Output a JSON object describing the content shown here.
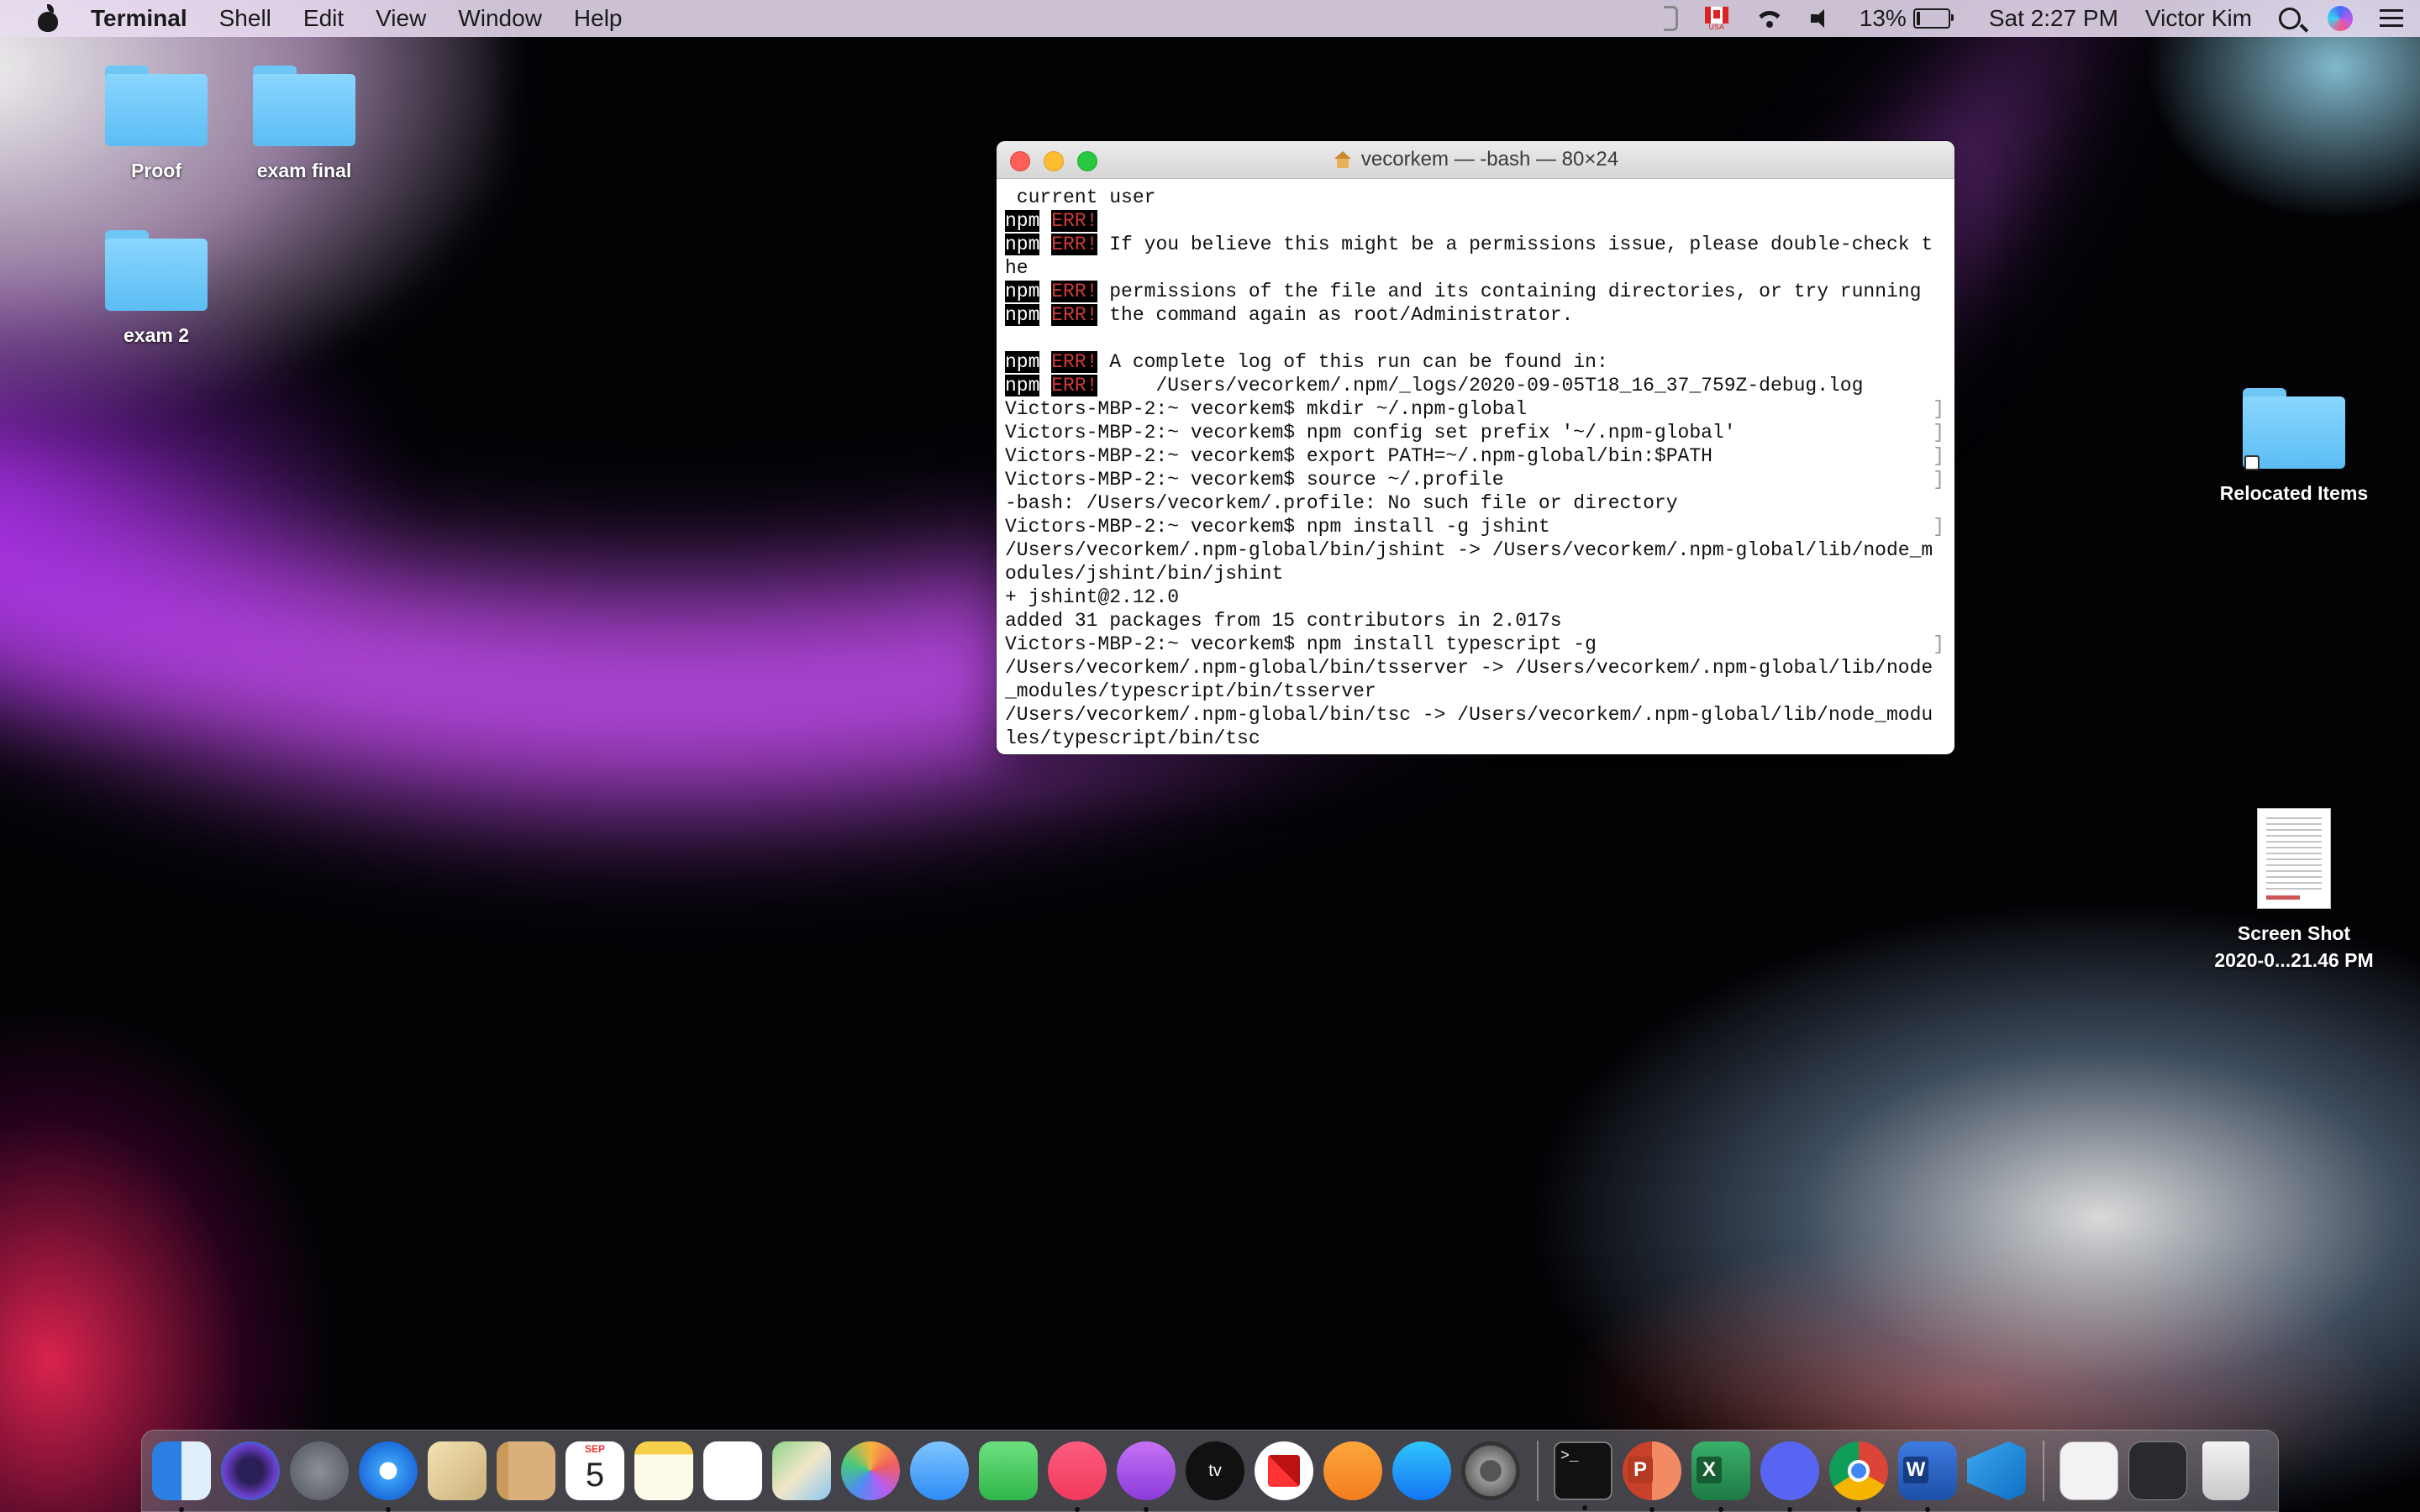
{
  "menubar": {
    "app_name": "Terminal",
    "menus": [
      "Shell",
      "Edit",
      "View",
      "Window",
      "Help"
    ],
    "status": {
      "flag_label": "USA",
      "battery_percent": "13%",
      "battery_level": 0.13,
      "clock": "Sat 2:27 PM",
      "user_name": "Victor Kim"
    }
  },
  "desktop": {
    "icons": [
      {
        "label": "Proof",
        "type": "folder"
      },
      {
        "label": "exam final",
        "type": "folder"
      },
      {
        "label": "exam 2",
        "type": "folder"
      },
      {
        "label": "Relocated Items",
        "type": "folder-alias"
      },
      {
        "label_line1": "Screen Shot",
        "label_line2": "2020-0...21.46 PM",
        "type": "screenshot"
      }
    ]
  },
  "terminal": {
    "title": "vecorkem — -bash — 80×24",
    "lines": [
      {
        "text": " current user"
      },
      {
        "npm": "npm",
        "err": "ERR!",
        "text": ""
      },
      {
        "npm": "npm",
        "err": "ERR!",
        "text": " If you believe this might be a permissions issue, please double-check t"
      },
      {
        "text": "he"
      },
      {
        "npm": "npm",
        "err": "ERR!",
        "text": " permissions of the file and its containing directories, or try running"
      },
      {
        "npm": "npm",
        "err": "ERR!",
        "text": " the command again as root/Administrator."
      },
      {
        "text": ""
      },
      {
        "npm": "npm",
        "err": "ERR!",
        "text": " A complete log of this run can be found in:"
      },
      {
        "npm": "npm",
        "err": "ERR!",
        "text": "     /Users/vecorkem/.npm/_logs/2020-09-05T18_16_37_759Z-debug.log"
      },
      {
        "text": "Victors-MBP-2:~ vecorkem$ mkdir ~/.npm-global",
        "mark": true
      },
      {
        "text": "Victors-MBP-2:~ vecorkem$ npm config set prefix '~/.npm-global'",
        "mark": true
      },
      {
        "text": "Victors-MBP-2:~ vecorkem$ export PATH=~/.npm-global/bin:$PATH",
        "mark": true
      },
      {
        "text": "Victors-MBP-2:~ vecorkem$ source ~/.profile",
        "mark": true
      },
      {
        "text": "-bash: /Users/vecorkem/.profile: No such file or directory"
      },
      {
        "text": "Victors-MBP-2:~ vecorkem$ npm install -g jshint",
        "mark": true
      },
      {
        "text": "/Users/vecorkem/.npm-global/bin/jshint -> /Users/vecorkem/.npm-global/lib/node_m"
      },
      {
        "text": "odules/jshint/bin/jshint"
      },
      {
        "text": "+ jshint@2.12.0"
      },
      {
        "text": "added 31 packages from 15 contributors in 2.017s"
      },
      {
        "text": "Victors-MBP-2:~ vecorkem$ npm install typescript -g",
        "mark": true
      },
      {
        "text": "/Users/vecorkem/.npm-global/bin/tsserver -> /Users/vecorkem/.npm-global/lib/node"
      },
      {
        "text": "_modules/typescript/bin/tsserver"
      },
      {
        "text": "/Users/vecorkem/.npm-global/bin/tsc -> /Users/vecorkem/.npm-global/lib/node_modu"
      },
      {
        "text": "les/typescript/bin/tsc"
      }
    ]
  },
  "dock": {
    "calendar_month": "SEP",
    "calendar_day": "5",
    "tv_label": "tv",
    "terminal_prompt": ">_",
    "apps": [
      {
        "name": "finder-icon",
        "running": true
      },
      {
        "name": "siri-icon",
        "running": false
      },
      {
        "name": "launchpad-icon",
        "running": false
      },
      {
        "name": "safari-icon",
        "running": true
      },
      {
        "name": "mail-icon",
        "running": false
      },
      {
        "name": "contacts-icon",
        "running": false
      },
      {
        "name": "calendar-icon",
        "running": false
      },
      {
        "name": "notes-icon",
        "running": false
      },
      {
        "name": "reminders-icon",
        "running": false
      },
      {
        "name": "maps-icon",
        "running": false
      },
      {
        "name": "photos-icon",
        "running": false
      },
      {
        "name": "messages-icon",
        "running": false
      },
      {
        "name": "facetime-icon",
        "running": false
      },
      {
        "name": "music-icon",
        "running": true
      },
      {
        "name": "podcasts-icon",
        "running": true
      },
      {
        "name": "tv-icon",
        "running": false
      },
      {
        "name": "news-icon",
        "running": false
      },
      {
        "name": "books-icon",
        "running": false
      },
      {
        "name": "appstore-icon",
        "running": false
      },
      {
        "name": "system-preferences-icon",
        "running": false
      },
      {
        "name": "terminal-icon",
        "running": true
      },
      {
        "name": "powerpoint-icon",
        "running": true
      },
      {
        "name": "excel-icon",
        "running": true
      },
      {
        "name": "discord-icon",
        "running": true
      },
      {
        "name": "chrome-icon",
        "running": true
      },
      {
        "name": "word-icon",
        "running": true
      },
      {
        "name": "vscode-icon",
        "running": true
      }
    ]
  }
}
